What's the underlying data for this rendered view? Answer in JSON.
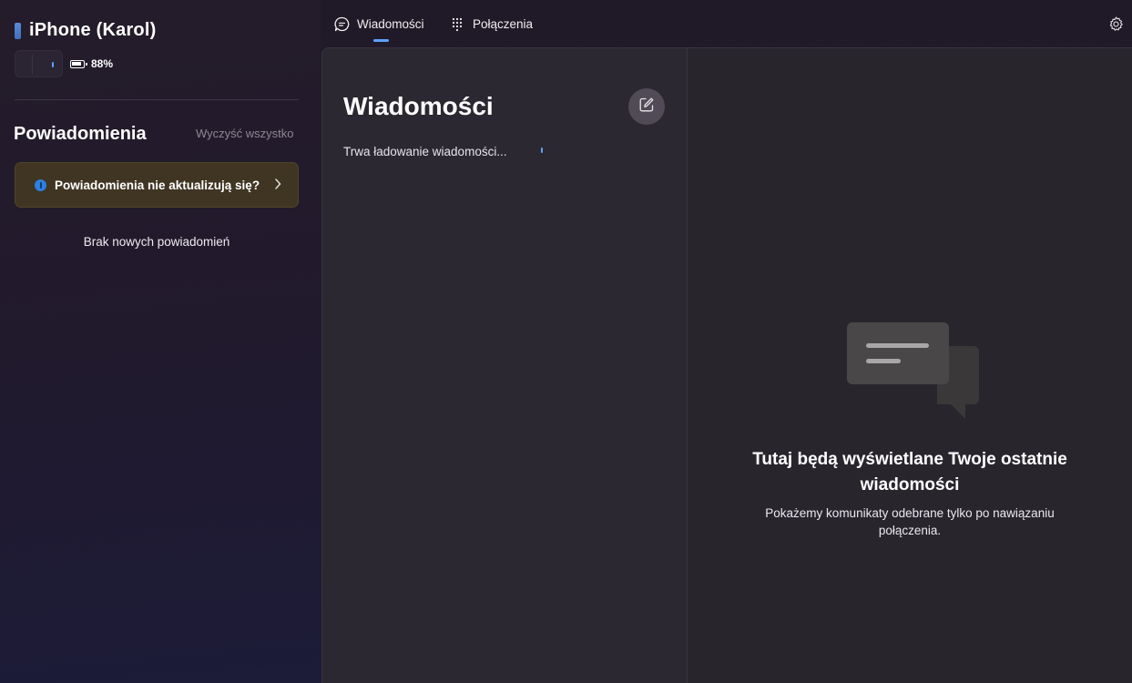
{
  "device": {
    "name": "iPhone (Karol)",
    "battery_percent": "88%",
    "battery_level": 0.88
  },
  "notifications": {
    "title": "Powiadomienia",
    "clear_all": "Wyczyść wszystko",
    "banner_text": "Powiadomienia nie aktualizują się?",
    "empty_text": "Brak nowych powiadomień"
  },
  "nav": {
    "tabs": [
      {
        "label": "Wiadomości",
        "icon": "chat-bubble-icon",
        "active": true
      },
      {
        "label": "Połączenia",
        "icon": "dialpad-icon",
        "active": false
      }
    ],
    "settings_icon": "gear-icon"
  },
  "messages": {
    "title": "Wiadomości",
    "loading": "Trwa ładowanie wiadomości...",
    "compose_icon": "compose-icon"
  },
  "detail": {
    "empty_title": "Tutaj będą wyświetlane Twoje ostatnie wiadomości",
    "empty_subtitle": "Pokażemy komunikaty odebrane tylko po nawiązaniu połączenia.",
    "illustration_icon": "chat-bubbles-icon"
  },
  "colors": {
    "accent": "#5fa0ff",
    "banner_bg": "#3f3522",
    "info_dot": "#2d7fe0"
  }
}
